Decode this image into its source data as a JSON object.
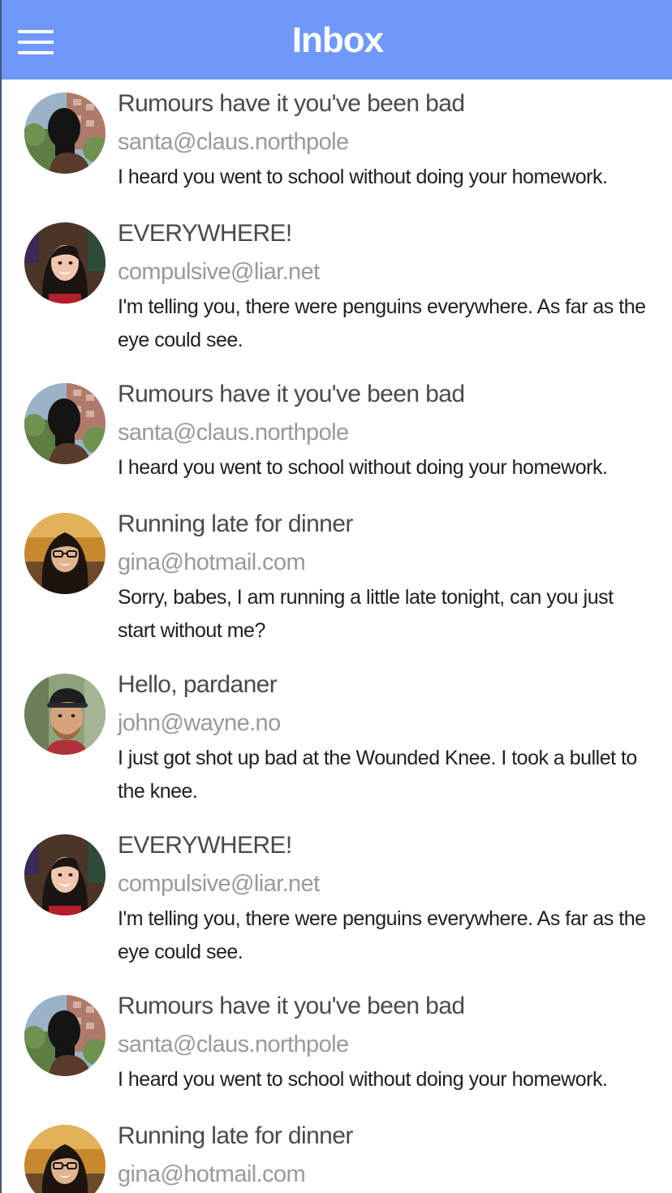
{
  "header": {
    "title": "Inbox",
    "menu_icon": "hamburger-menu-icon",
    "background_color": "#7098fb"
  },
  "messages": [
    {
      "subject": "Rumours have it you've been bad",
      "sender": "santa@claus.northpole",
      "body": "I heard you went to school without doing your homework.",
      "avatar": "masked-man-avatar"
    },
    {
      "subject": "EVERYWHERE!",
      "sender": "compulsive@liar.net",
      "body": "I'm telling you, there were penguins everywhere. As far as the eye could see.",
      "avatar": "smiling-woman-avatar"
    },
    {
      "subject": "Rumours have it you've been bad",
      "sender": "santa@claus.northpole",
      "body": "I heard you went to school without doing your homework.",
      "avatar": "masked-man-avatar"
    },
    {
      "subject": "Running late for dinner",
      "sender": "gina@hotmail.com",
      "body": "Sorry, babes, I am running a little late tonight, can you just start without me?",
      "avatar": "woman-with-glasses-avatar"
    },
    {
      "subject": "Hello, pardaner",
      "sender": "john@wayne.no",
      "body": "I just got shot up bad at the Wounded Knee. I took a bullet to the knee.",
      "avatar": "man-with-cap-avatar"
    },
    {
      "subject": "EVERYWHERE!",
      "sender": "compulsive@liar.net",
      "body": "I'm telling you, there were penguins everywhere. As far as the eye could see.",
      "avatar": "smiling-woman-avatar"
    },
    {
      "subject": "Rumours have it you've been bad",
      "sender": "santa@claus.northpole",
      "body": "I heard you went to school without doing your homework.",
      "avatar": "masked-man-avatar"
    },
    {
      "subject": "Running late for dinner",
      "sender": "gina@hotmail.com",
      "body": "",
      "avatar": "woman-with-glasses-avatar"
    }
  ]
}
